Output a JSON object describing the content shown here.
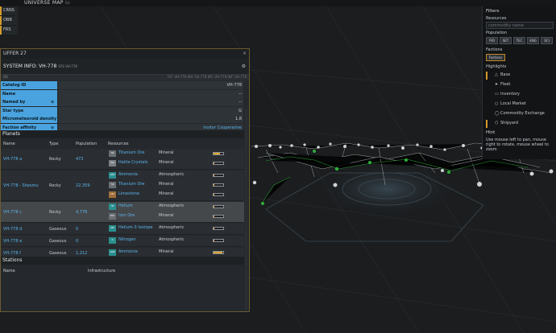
{
  "map": {
    "title": "UNIVERSE MAP",
    "version": "SU"
  },
  "side_tabs": [
    "CRNS",
    "OBB",
    "FRS"
  ],
  "system_window": {
    "buffer_label": "UFFER 27",
    "close_glyph": "×",
    "title": "SYSTEM INFO: VH-778",
    "title_sub": "SYS VH-778",
    "tagline_left": "OS",
    "tagline_right": "FLT: VH-778   INV: VH-778   MS: VH-778   INF: VH-778",
    "properties": [
      {
        "key": "Catalog ID",
        "value": "VH-778",
        "link": false,
        "info": false
      },
      {
        "key": "Name",
        "value": "--",
        "link": false,
        "info": false
      },
      {
        "key": "Named by",
        "value": "--",
        "link": false,
        "info": true
      },
      {
        "key": "Star type",
        "value": "G",
        "link": false,
        "info": false
      },
      {
        "key": "Micrometeoroid density",
        "value": "1.8",
        "link": false,
        "info": false
      },
      {
        "key": "Faction affinity",
        "value": "Insitor Cooperative",
        "link": true,
        "info": true
      }
    ],
    "planets_header": "Planets",
    "planet_columns": {
      "name": "Name",
      "type": "Type",
      "population": "Population",
      "resources": "Resources"
    },
    "planets": [
      {
        "name": "VH-778 a",
        "type": "Rocky",
        "population": "472",
        "selected": false,
        "resources": [
          {
            "abbr": "TIO",
            "name": "Titanium Ore",
            "category": "Mineral",
            "color": "#6a6f74",
            "level": 0.7
          },
          {
            "abbr": "HAL",
            "name": "Halite Crystals",
            "category": "Mineral",
            "color": "#7a7f84",
            "level": 0.1
          }
        ]
      },
      {
        "name": "VH-778 - Shesmu",
        "type": "Rocky",
        "population": "22,359",
        "selected": false,
        "resources": [
          {
            "abbr": "AMM",
            "name": "Ammonia",
            "category": "Atmospheric",
            "color": "#2a8f8f",
            "level": 0.1
          },
          {
            "abbr": "TIO",
            "name": "Titanium Ore",
            "category": "Mineral",
            "color": "#6a6f74",
            "level": 0.1
          },
          {
            "abbr": "LST",
            "name": "Limestone",
            "category": "Mineral",
            "color": "#a0703a",
            "level": 0.1
          }
        ]
      },
      {
        "name": "VH-778 c",
        "type": "Rocky",
        "population": "4,776",
        "selected": true,
        "resources": [
          {
            "abbr": "HE",
            "name": "Helium",
            "category": "Atmospheric",
            "color": "#2a8f8f",
            "level": 0.1
          },
          {
            "abbr": "FEO",
            "name": "Iron Ore",
            "category": "Mineral",
            "color": "#6a6f74",
            "level": 0.1
          }
        ]
      },
      {
        "name": "VH-778 d",
        "type": "Gaseous",
        "population": "0",
        "selected": false,
        "resources": [
          {
            "abbr": "HE3",
            "name": "Helium-3 Isotope",
            "category": "Atmospheric",
            "color": "#2a8f8f",
            "level": 0.1
          }
        ]
      },
      {
        "name": "VH-778 e",
        "type": "Gaseous",
        "population": "0",
        "selected": false,
        "resources": [
          {
            "abbr": "N",
            "name": "Nitrogen",
            "category": "Atmospheric",
            "color": "#2a8f8f",
            "level": 0.1
          }
        ]
      },
      {
        "name": "VH-778 f",
        "type": "Gaseous",
        "population": "1,212",
        "selected": false,
        "resources": [
          {
            "abbr": "AMM",
            "name": "Ammonia",
            "category": "Mineral",
            "color": "#2a8f8f",
            "level": 0.9
          }
        ]
      }
    ],
    "stations_header": "Stations",
    "station_columns": {
      "name": "Name",
      "infrastructure": "Infrastructure"
    }
  },
  "filters": {
    "title": "Filters",
    "resources_label": "Resources",
    "search_placeholder": "commodity name",
    "population_label": "Population",
    "population_buttons": [
      "PIO",
      "SET",
      "TEC",
      "ENG",
      "SCI"
    ],
    "factions_label": "Factions",
    "factions_button": "Factions",
    "highlights_label": "Highlights",
    "highlights": [
      {
        "label": "Base",
        "icon": "base-icon",
        "glyph": "△",
        "checked": true
      },
      {
        "label": "Fleet",
        "icon": "fleet-icon",
        "glyph": "➤",
        "checked": false
      },
      {
        "label": "Inventory",
        "icon": "inventory-icon",
        "glyph": "▭",
        "checked": false
      },
      {
        "label": "Local Market",
        "icon": "market-icon",
        "glyph": "○",
        "checked": false
      },
      {
        "label": "Commodity Exchange",
        "icon": "exchange-icon",
        "glyph": "◯",
        "checked": false
      },
      {
        "label": "Shipyard",
        "icon": "shipyard-icon",
        "glyph": "⬡",
        "checked": true
      }
    ],
    "hint_title": "Hint",
    "hint_text": "Use mouse left to pan, mouse right to rotate, mouse wheel to zoom"
  },
  "colors": {
    "accent": "#d49a2a",
    "link": "#5ab4ec",
    "header_blue": "#4aa3df",
    "map_node_green": "#2fae3a"
  }
}
